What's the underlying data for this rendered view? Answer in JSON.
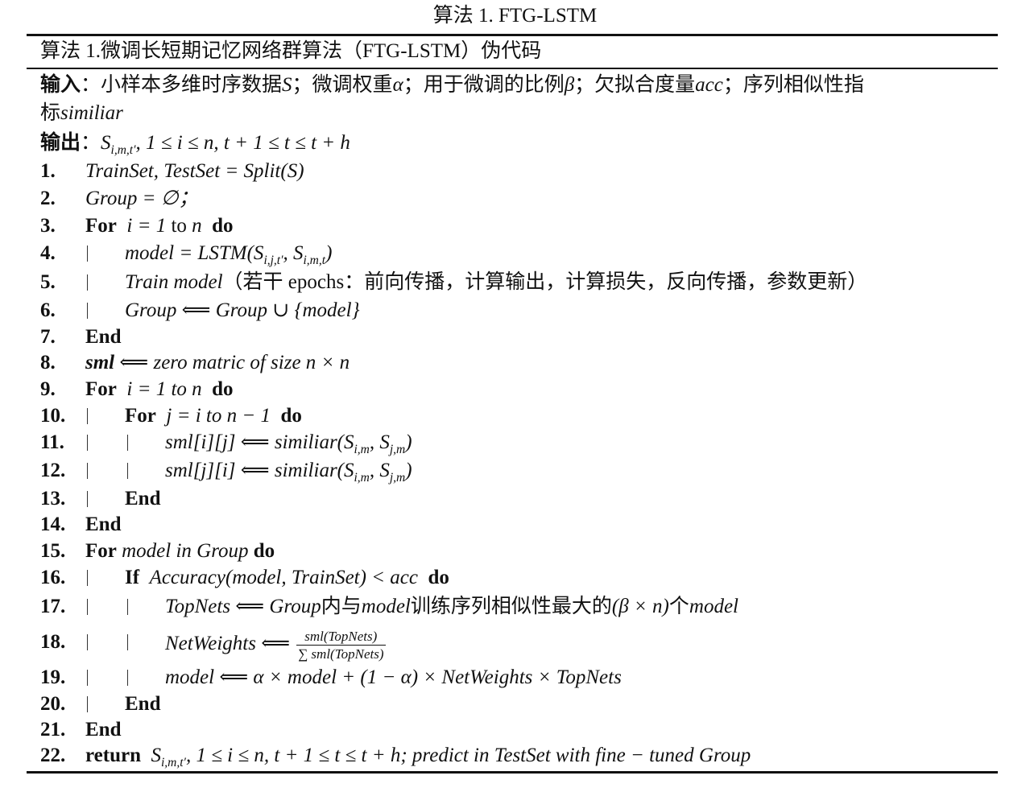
{
  "caption": "算法 1. FTG-LSTM",
  "header": "算法 1.微调长短期记忆网络群算法（FTG-LSTM）伪代码",
  "input": {
    "label": "输入",
    "colon": "：",
    "p1": "小样本多维时序数据",
    "v1": "S",
    "p2": "；微调权重",
    "v2": "α",
    "p3": "；用于微调的比例",
    "v3": "β",
    "p4": "；欠拟合度量",
    "v4": "acc",
    "p5": "；序列相似性指",
    "p6": "标",
    "v5": "similiar"
  },
  "output": {
    "label": "输出",
    "colon": "：",
    "expr_base": "S",
    "expr_sub": "i,m,t′",
    "expr_rest": ", 1 ≤ i ≤ n, t + 1 ≤ t ≤ t + h"
  },
  "steps": [
    {
      "num": "1.",
      "code": "TrainSet, TestSet = Split(S)"
    },
    {
      "num": "2.",
      "code": "Group = ∅；"
    },
    {
      "num": "3.",
      "kw1": "For",
      "expr": "i = 1",
      "to": "to",
      "n": "n",
      "kw2": "do"
    },
    {
      "num": "4.",
      "a": "model = LSTM(S",
      "sub1": "i,j,t′",
      "b": ", S",
      "sub2": "i,m,t",
      "c": ")"
    },
    {
      "num": "5.",
      "a": "Train model",
      "b": "（若干 epochs：前向传播，计算输出，计算损失，反向传播，参数更新）"
    },
    {
      "num": "6.",
      "code": "Group ⟸ Group ∪ {model}"
    },
    {
      "num": "7.",
      "kw1": "End"
    },
    {
      "num": "8.",
      "kw1": "sml",
      "code": "⟸ zero matric of size n × n"
    },
    {
      "num": "9.",
      "kw1": "For",
      "code": "i  =  1 to n",
      "kw2": "do"
    },
    {
      "num": "10.",
      "kw1": "For",
      "code": "j  =  i to n − 1",
      "kw2": "do"
    },
    {
      "num": "11.",
      "a": "sml[i][j]  ⟸  similiar(S",
      "sub1": "i,m",
      "b": ", S",
      "sub2": "j,m",
      "c": ")"
    },
    {
      "num": "12.",
      "a": "sml[j][i]  ⟸  similiar(S",
      "sub1": "i,m",
      "b": ", S",
      "sub2": "j,m",
      "c": ")"
    },
    {
      "num": "13.",
      "kw1": "End"
    },
    {
      "num": "14.",
      "kw1": "End"
    },
    {
      "num": "15.",
      "kw1": "For",
      "code": "model in Group",
      "kw2": "do"
    },
    {
      "num": "16.",
      "kw1": "If",
      "code": "Accuracy(model, TrainSet)  <  acc",
      "kw2": "do"
    },
    {
      "num": "17.",
      "a": "TopNets ⟸ Group",
      "b": "内与",
      "c": "model",
      "d": "训练序列相似性最大的",
      "e": "(β × n)",
      "f": "个",
      "g": "model"
    },
    {
      "num": "18.",
      "a": "NetWeights  ⟸",
      "numer": "sml(TopNets)",
      "denom": "∑ sml(TopNets)"
    },
    {
      "num": "19.",
      "code": "model  ⟸  α × model + (1 − α) × NetWeights × TopNets"
    },
    {
      "num": "20.",
      "kw1": "End"
    },
    {
      "num": "21.",
      "kw1": "End"
    },
    {
      "num": "22.",
      "kw1": "return",
      "base": "S",
      "sub": "i,m,t′",
      "rest": ", 1 ≤ i ≤ n, t + 1 ≤ t ≤ t + h; predict in TestSet with fine − tuned Group"
    }
  ]
}
